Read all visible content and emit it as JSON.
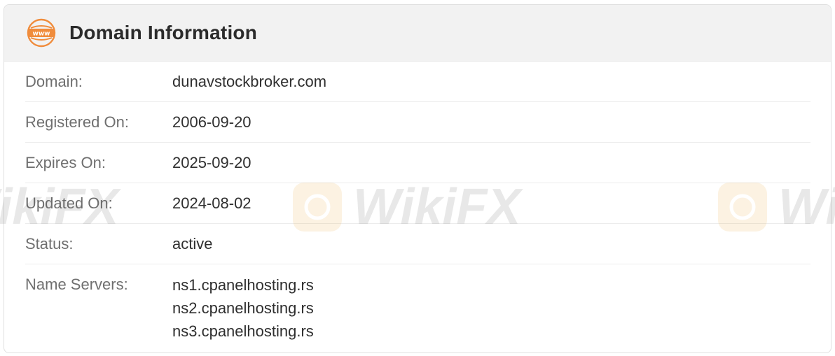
{
  "header": {
    "icon": "www-globe-icon",
    "accent_color": "#f08c3c",
    "title": "Domain Information"
  },
  "rows": [
    {
      "label": "Domain:",
      "value": "dunavstockbroker.com"
    },
    {
      "label": "Registered On:",
      "value": "2006-09-20"
    },
    {
      "label": "Expires On:",
      "value": "2025-09-20"
    },
    {
      "label": "Updated On:",
      "value": "2024-08-02"
    },
    {
      "label": "Status:",
      "value": "active"
    }
  ],
  "name_servers": {
    "label": "Name Servers:",
    "values": [
      "ns1.cpanelhosting.rs",
      "ns2.cpanelhosting.rs",
      "ns3.cpanelhosting.rs"
    ]
  },
  "watermark": {
    "text": "WikiFX",
    "logo_color": "#e9a12c"
  }
}
